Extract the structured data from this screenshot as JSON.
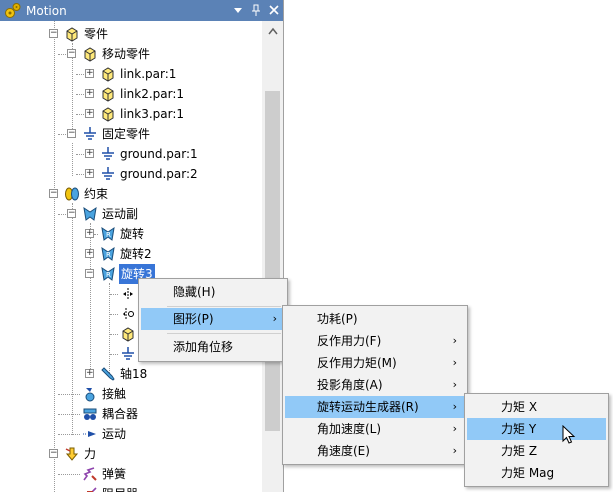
{
  "panel": {
    "title": "Motion",
    "buttons": [
      "▼",
      "ꟷ",
      "✕"
    ]
  },
  "tree": {
    "parts": "零件",
    "moving_parts": "移动零件",
    "link1": "link.par:1",
    "link2": "link2.par:1",
    "link3": "link3.par:1",
    "fixed_parts": "固定零件",
    "ground1": "ground.par:1",
    "ground2": "ground.par:2",
    "constraints": "约束",
    "joints": "运动副",
    "rev1": "旋转",
    "rev2": "旋转2",
    "rev3": "旋转3",
    "axis18": "轴18",
    "contact": "接触",
    "coupler": "耦合器",
    "motion": "运动",
    "forces": "力",
    "spring": "弹簧",
    "damper": "阻尼器"
  },
  "menu1": {
    "hide": "隐藏(H)",
    "graph": "图形(P)",
    "add_angle": "添加角位移"
  },
  "menu2": {
    "power": "功耗(P)",
    "reaction_force": "反作用力(F)",
    "reaction_torque": "反作用力矩(M)",
    "projected_angle": "投影角度(A)",
    "rotational_motion_gen": "旋转运动生成器(R)",
    "angular_accel": "角加速度(L)",
    "angular_velocity": "角速度(E)"
  },
  "menu3": {
    "torque_x": "力矩 X",
    "torque_y": "力矩 Y",
    "torque_z": "力矩 Z",
    "torque_mag": "力矩 Mag"
  },
  "colors": {
    "title_bg": "#5b82b6",
    "selection": "#3875d7",
    "menu_highlight": "#91c9f7"
  }
}
